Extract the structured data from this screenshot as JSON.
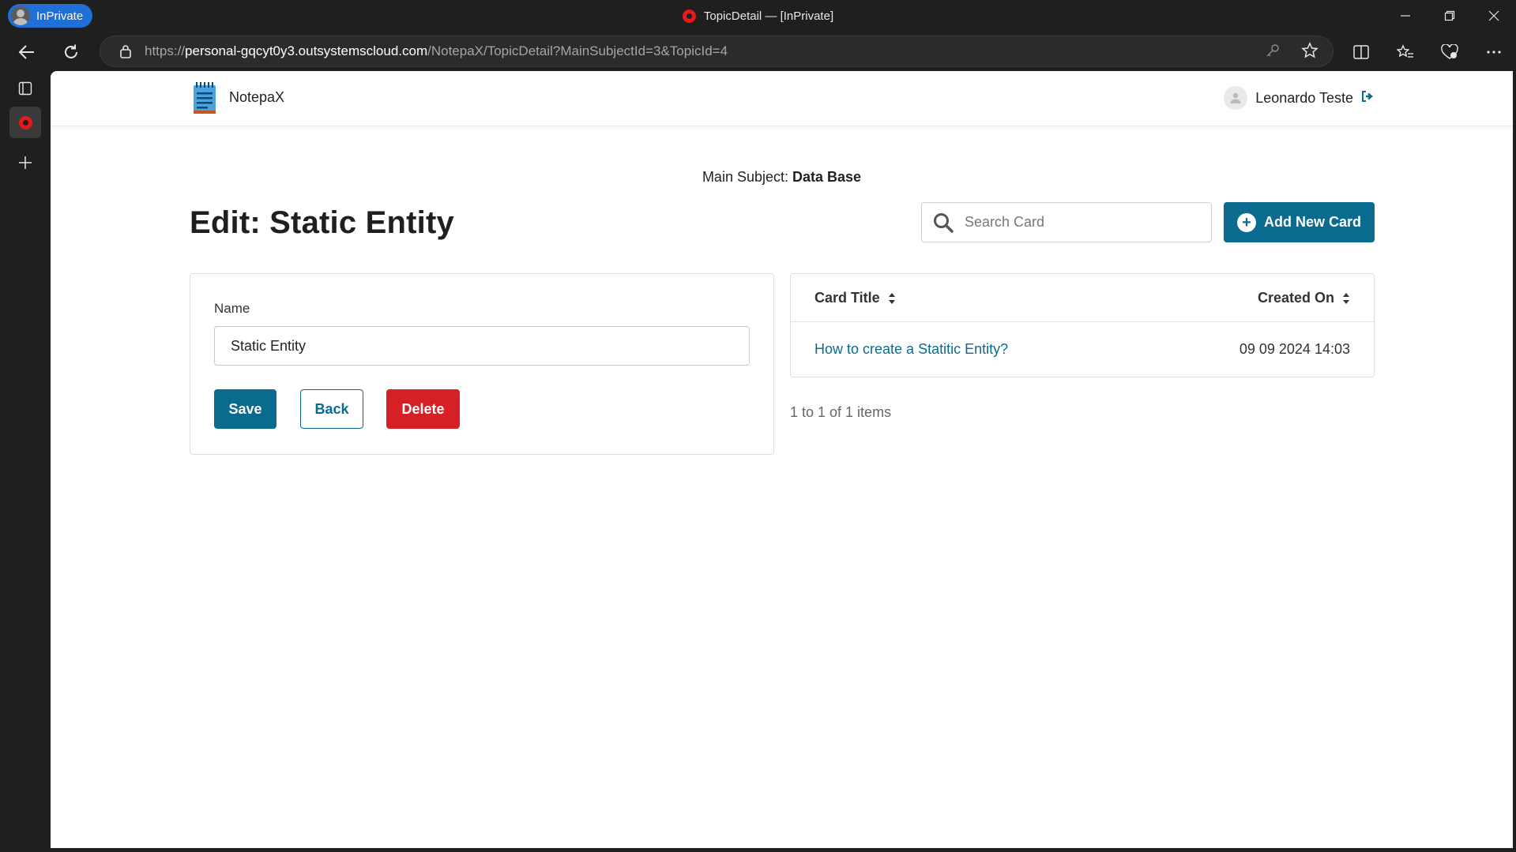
{
  "browser": {
    "profile_label": "InPrivate",
    "window_title": "TopicDetail — [InPrivate]",
    "url_prefix": "https://",
    "url_host": "personal-gqcyt0y3.outsystemscloud.com",
    "url_path": "/NotepaX/TopicDetail?MainSubjectId=3&TopicId=4"
  },
  "app": {
    "name": "NotepaX",
    "user_name": "Leonardo Teste"
  },
  "main": {
    "subject_prefix": "Main Subject:",
    "subject_name": "Data Base",
    "page_title": "Edit: Static Entity",
    "search_placeholder": "Search Card",
    "add_button_label": "Add New Card"
  },
  "form": {
    "name_label": "Name",
    "name_value": "Static Entity",
    "save_label": "Save",
    "back_label": "Back",
    "delete_label": "Delete"
  },
  "table": {
    "columns": [
      "Card Title",
      "Created On"
    ],
    "rows": [
      {
        "title": "How to create a Statitic Entity?",
        "created_on": "09 09 2024 14:03"
      }
    ],
    "pagination": "1 to 1 of 1 items"
  },
  "colors": {
    "primary": "#0b6b8f",
    "danger": "#d71f26",
    "browser_bg": "#1f1f1f",
    "inprivate_badge": "#1f6fd6"
  }
}
